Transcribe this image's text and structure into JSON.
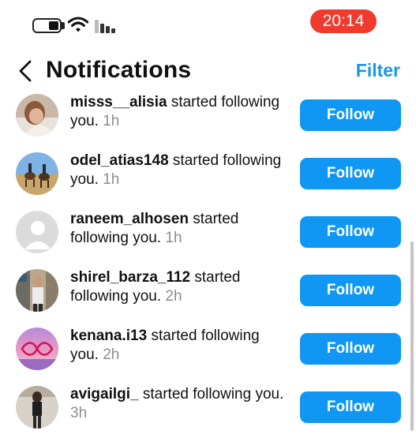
{
  "status_bar": {
    "time": "20:14",
    "battery_level": 0.35,
    "icons": [
      "battery-icon",
      "wifi-icon",
      "signal-icon"
    ]
  },
  "header": {
    "title": "Notifications",
    "filter_label": "Filter",
    "back_icon": "chevron-left-icon"
  },
  "colors": {
    "accent": "#0f97f3",
    "filter": "#1898e8",
    "time_pill": "#f03a2e",
    "secondary_text": "#8e8e8e"
  },
  "notifications": [
    {
      "username": "misss__alisia",
      "action": " started following you.",
      "time": "1h",
      "button": "Follow"
    },
    {
      "username": "odel_atias148",
      "action": " started following you.",
      "time": "1h",
      "button": "Follow"
    },
    {
      "username": "raneem_alhosen",
      "action": " started following you.",
      "time": "1h",
      "button": "Follow"
    },
    {
      "username": "shirel_barza_112",
      "action": " started following you.",
      "time": "2h",
      "button": "Follow"
    },
    {
      "username": "kenana.i13",
      "action": " started following you.",
      "time": "2h",
      "button": "Follow"
    },
    {
      "username": "avigailgi_",
      "action": " started following you.",
      "time": "3h",
      "button": "Follow"
    }
  ]
}
